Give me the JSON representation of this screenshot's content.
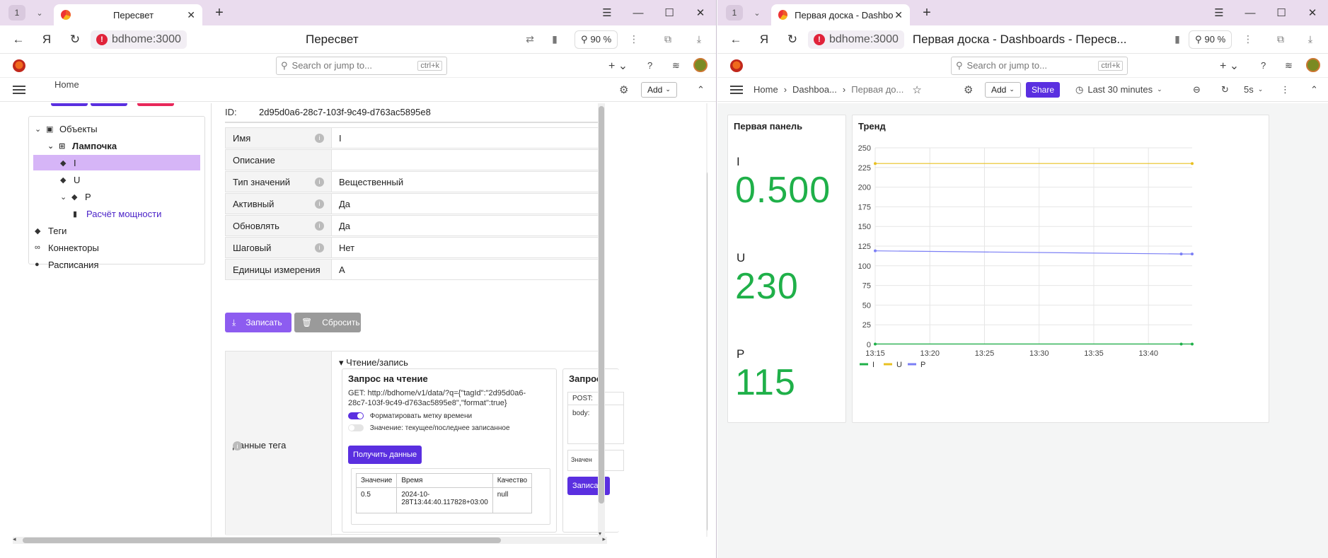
{
  "left": {
    "tab_count": "1",
    "tab_title": "Пересвет",
    "url": "bdhome:3000",
    "page_title": "Пересвет",
    "zoom": "90 %",
    "search_placeholder": "Search or jump to...",
    "search_kbd": "ctrl+k",
    "breadcrumb_home": "Home",
    "add_label": "Add",
    "tree": [
      {
        "label": "Объекты",
        "level": 0,
        "chev": "⌄",
        "icon": "▣"
      },
      {
        "label": "Лампочка",
        "level": 1,
        "chev": "⌄",
        "icon": "⊞",
        "bold": true
      },
      {
        "label": "I",
        "level": 2,
        "chev": "",
        "icon": "◆",
        "selected": true
      },
      {
        "label": "U",
        "level": 2,
        "chev": "",
        "icon": "◆"
      },
      {
        "label": "P",
        "level": 2,
        "chev": "⌄",
        "icon": "◆"
      },
      {
        "label": "Расчёт мощности",
        "level": 3,
        "chev": "",
        "icon": "▮",
        "link": true
      },
      {
        "label": "Теги",
        "level": 0,
        "chev": "",
        "icon": "◆"
      },
      {
        "label": "Коннекторы",
        "level": 0,
        "chev": "",
        "icon": "∞"
      },
      {
        "label": "Расписания",
        "level": 0,
        "chev": "",
        "icon": "●"
      }
    ],
    "id_label": "ID:",
    "id_value": "2d95d0a6-28c7-103f-9c49-d763ac5895e8",
    "fields": [
      {
        "label": "Имя",
        "value": "I",
        "info": true
      },
      {
        "label": "Описание",
        "value": "",
        "info": false
      },
      {
        "label": "Тип значений",
        "value": "Вещественный",
        "info": true
      },
      {
        "label": "Активный",
        "value": "Да",
        "info": true
      },
      {
        "label": "Обновлять",
        "value": "Да",
        "info": true
      },
      {
        "label": "Шаговый",
        "value": "Нет",
        "info": true
      },
      {
        "label": "Единицы измерения",
        "value": "A",
        "info": false
      }
    ],
    "save_label": "Записать",
    "reset_label": "Сбросить",
    "tag_data_label": "Данные тега",
    "rw_title": "Чтение/запись",
    "read_card": {
      "title": "Запрос на чтение",
      "get_line1": "GET:  http://bdhome/v1/data/?q={\"tagId\":\"2d95d0a6-",
      "get_line2": "28c7-103f-9c49-d763ac5895e8\",\"format\":true}",
      "toggle1": "Форматировать метку времени",
      "toggle2": "Значение: текущее/последнее записанное",
      "button": "Получить данные",
      "table_headers": [
        "Значение",
        "Время",
        "Качество"
      ],
      "table_row": [
        "0.5",
        "2024-10-28T13:44:40.117828+03:00",
        "null"
      ]
    },
    "write_card": {
      "title": "Запрос",
      "post": "POST:",
      "body": "body:",
      "value": "Значен",
      "button": "Записа"
    }
  },
  "right": {
    "tab_count": "1",
    "tab_title": "Первая доска - Dashbo",
    "url": "bdhome:3000",
    "page_title": "Первая доска - Dashboards - Пересв...",
    "zoom": "90 %",
    "search_placeholder": "Search or jump to...",
    "search_kbd": "ctrl+k",
    "crumbs": [
      "Home",
      "Dashboa...",
      "Первая до..."
    ],
    "add_label": "Add",
    "share_label": "Share",
    "time_range": "Last 30 minutes",
    "refresh": "5s",
    "stat_panel": {
      "title": "Первая панель",
      "items": [
        {
          "label": "I",
          "value": "0.500"
        },
        {
          "label": "U",
          "value": "230"
        },
        {
          "label": "P",
          "value": "115"
        }
      ]
    },
    "trend_title": "Тренд"
  },
  "chart_data": {
    "type": "line",
    "title": "Тренд",
    "xlabel": "",
    "ylabel": "",
    "x_ticks": [
      "13:15",
      "13:20",
      "13:25",
      "13:30",
      "13:35",
      "13:40"
    ],
    "x_range_minutes": [
      13.25,
      13.75
    ],
    "ylim": [
      0,
      250
    ],
    "y_ticks": [
      0,
      25,
      50,
      75,
      100,
      125,
      150,
      175,
      200,
      225,
      250
    ],
    "grid": true,
    "legend": "bottom-left",
    "series": [
      {
        "name": "I",
        "color": "#1fb049",
        "x": [
          "13:15",
          "13:43",
          "13:44"
        ],
        "y": [
          0.5,
          0.5,
          0.5
        ]
      },
      {
        "name": "U",
        "color": "#e8c021",
        "x": [
          "13:15",
          "13:44"
        ],
        "y": [
          230,
          230
        ]
      },
      {
        "name": "P",
        "color": "#7b7ff5",
        "x": [
          "13:15",
          "13:43",
          "13:44"
        ],
        "y": [
          119,
          115,
          115
        ]
      }
    ]
  }
}
